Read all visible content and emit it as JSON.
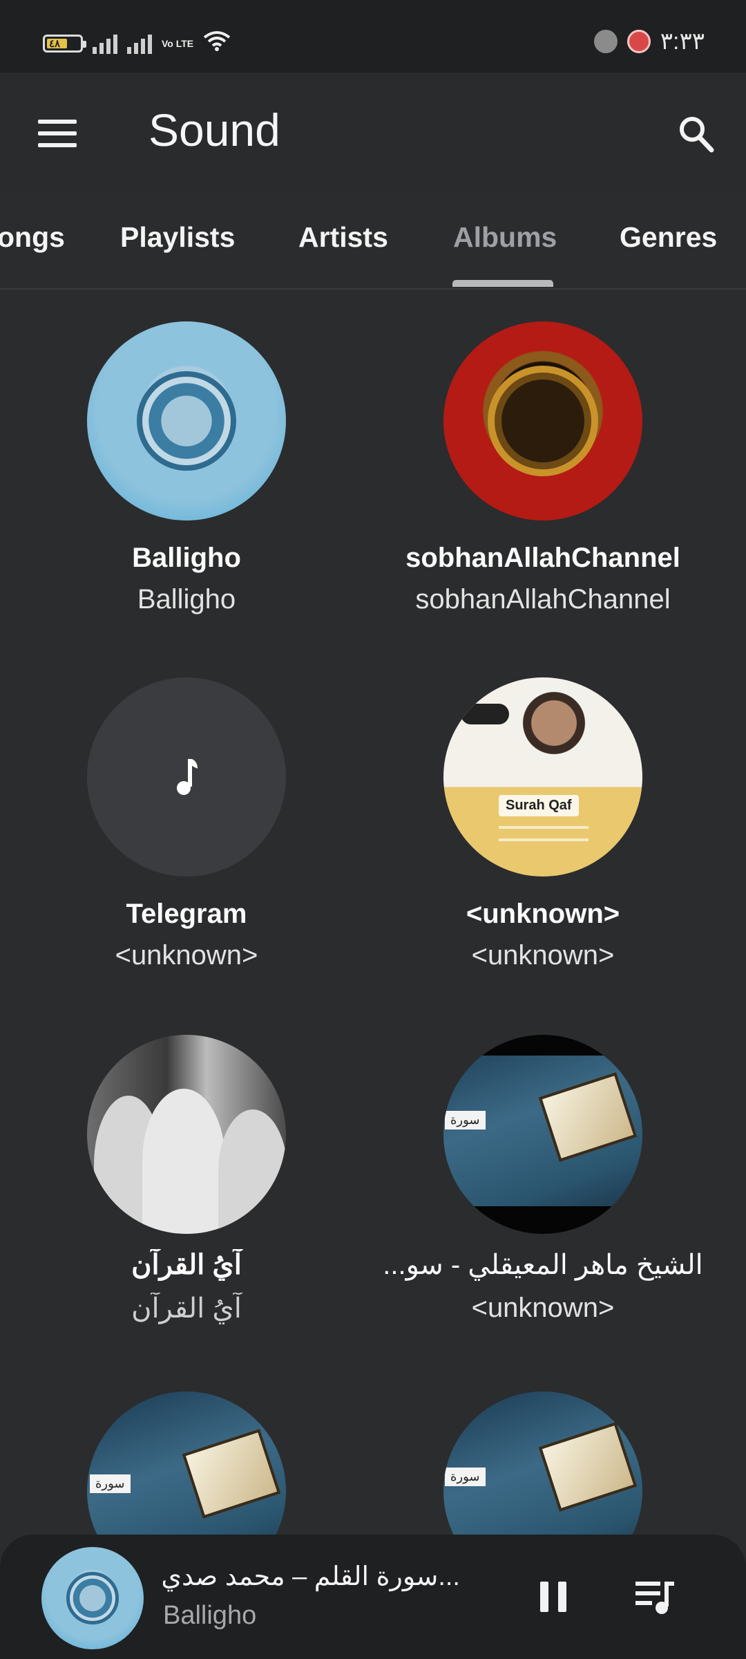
{
  "status_bar": {
    "battery_level": "٤٨",
    "network": "Vo LTE",
    "time": "٣:٣٣"
  },
  "app_bar": {
    "title": "Sound",
    "menu_icon": "hamburger-menu-icon",
    "search_icon": "search-icon"
  },
  "tabs": [
    {
      "label": "ongs"
    },
    {
      "label": "Playlists"
    },
    {
      "label": "Artists"
    },
    {
      "label": "Albums",
      "active": true
    },
    {
      "label": "Genres"
    }
  ],
  "albums": [
    {
      "title": "Balligho",
      "artist": "Balligho"
    },
    {
      "title": "sobhanAllahChannel",
      "artist": "sobhanAllahChannel"
    },
    {
      "title": "Telegram",
      "artist": "<unknown>"
    },
    {
      "title": "<unknown>",
      "artist": "<unknown>",
      "cover_label": "Surah Qaf"
    },
    {
      "title": "آيُ القرآن",
      "artist": "آيُ القرآن"
    },
    {
      "title": "...الشيخ ماهر المعيقلي - سو",
      "artist": "<unknown>"
    },
    {
      "title": "",
      "artist": ""
    },
    {
      "title": "",
      "artist": ""
    }
  ],
  "now_playing": {
    "title": "...سورة القلم – محمد صدي",
    "artist": "Balligho",
    "pause_icon": "pause-icon",
    "queue_icon": "queue-music-icon"
  },
  "colors": {
    "background": "#2b2c2e",
    "status_bar": "#1f2021",
    "active_tab": "#9da0a4",
    "player_bar": "#1f2022"
  }
}
